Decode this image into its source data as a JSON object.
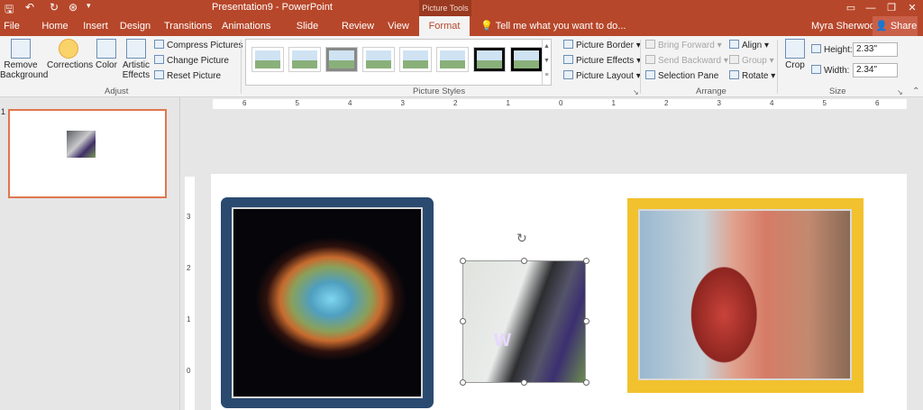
{
  "titlebar": {
    "document_title": "Presentation9 - PowerPoint",
    "contextual_group": "Picture Tools",
    "qat": {
      "save_icon": "save-icon",
      "undo_icon": "undo-icon",
      "redo_icon": "redo-icon",
      "touch_icon": "touch-mode-icon"
    }
  },
  "tabs": [
    "File",
    "Home",
    "Insert",
    "Design",
    "Transitions",
    "Animations",
    "Slide Show",
    "Review",
    "View",
    "Format"
  ],
  "active_tab": "Format",
  "tellme": "Tell me what you want to do...",
  "user": {
    "name": "Myra Sherwood",
    "share_label": "Share"
  },
  "ribbon": {
    "adjust": {
      "group_label": "Adjust",
      "remove_background": "Remove Background",
      "corrections": "Corrections",
      "color": "Color",
      "artistic_effects": "Artistic Effects",
      "compress": "Compress Pictures",
      "change": "Change Picture",
      "reset": "Reset Picture"
    },
    "picture_styles": {
      "group_label": "Picture Styles",
      "border": "Picture Border",
      "effects": "Picture Effects",
      "layout": "Picture Layout",
      "thumb_count": 8
    },
    "arrange": {
      "group_label": "Arrange",
      "bring_forward": "Bring Forward",
      "send_backward": "Send Backward",
      "selection_pane": "Selection Pane",
      "align": "Align",
      "group": "Group",
      "rotate": "Rotate"
    },
    "size": {
      "group_label": "Size",
      "crop": "Crop",
      "height_label": "Height:",
      "height_value": "2.33\"",
      "width_label": "Width:",
      "width_value": "2.34\""
    }
  },
  "slides_panel": {
    "slide_number": "1"
  },
  "rulers": {
    "horizontal_labels": [
      "6",
      "5",
      "4",
      "3",
      "2",
      "1",
      "0",
      "1",
      "2",
      "3",
      "4",
      "5",
      "6"
    ],
    "vertical_labels": [
      "3",
      "2",
      "1",
      "0"
    ]
  },
  "colors": {
    "accent": "#b7472a",
    "nebula_frame": "#2b4a70",
    "heart_frame": "#f2c12e"
  },
  "slide_images": {
    "nebula": "nebula-image",
    "husky": "husky-image",
    "husky_letter": "W",
    "heart": "anatomy-heart-image"
  }
}
